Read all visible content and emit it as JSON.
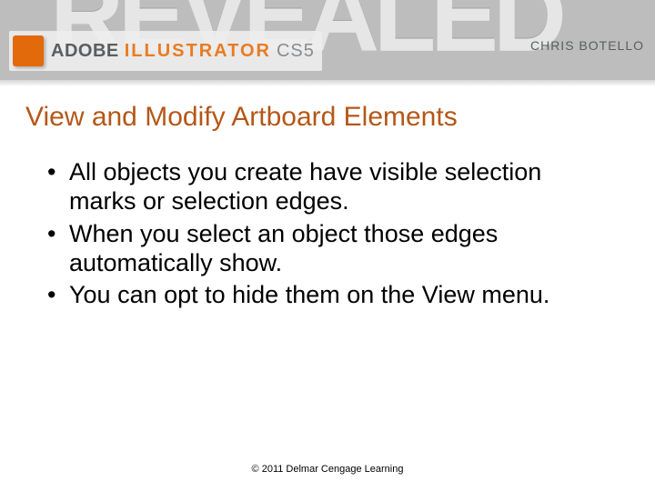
{
  "banner": {
    "revealed": "REVEALED",
    "adobe": "ADOBE",
    "product": "ILLUSTRATOR",
    "version": "CS5",
    "author": "CHRIS BOTELLO"
  },
  "slide": {
    "title": "View and Modify Artboard Elements",
    "bullets": [
      "All objects you create have visible selection marks or selection edges.",
      "When you select an object those edges automatically show.",
      "You can opt to hide them on the View menu."
    ],
    "footer": "© 2011 Delmar Cengage Learning"
  }
}
